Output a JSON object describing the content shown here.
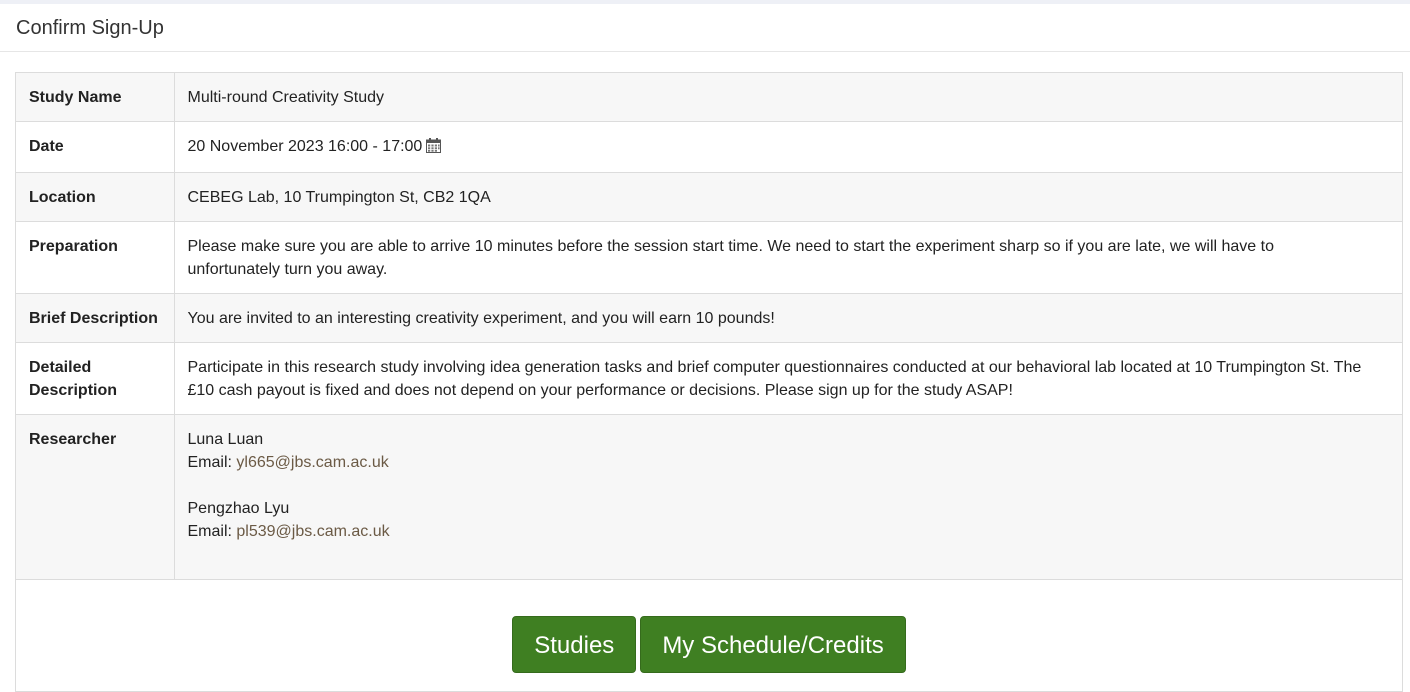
{
  "header": {
    "title": "Confirm Sign-Up"
  },
  "study": {
    "rows": {
      "study_name": {
        "label": "Study Name",
        "value": "Multi-round Creativity Study"
      },
      "date": {
        "label": "Date",
        "value": "20 November 2023 16:00 - 17:00",
        "icon": "calendar-icon"
      },
      "location": {
        "label": "Location",
        "value": "CEBEG Lab, 10 Trumpington St, CB2 1QA"
      },
      "preparation": {
        "label": "Preparation",
        "value": "Please make sure you are able to arrive 10 minutes before the session start time. We need to start the experiment sharp so if you are late, we will have to unfortunately turn you away."
      },
      "brief_description": {
        "label": "Brief Description",
        "value": "You are invited to an interesting creativity experiment, and you will earn 10 pounds!"
      },
      "detailed_description": {
        "label": "Detailed Description",
        "value": "Participate in this research study involving idea generation tasks and brief computer questionnaires conducted at our behavioral lab located at 10 Trumpington St. The £10 cash payout is fixed and does not depend on your performance or decisions. Please sign up for the study ASAP!"
      },
      "researcher": {
        "label": "Researcher",
        "email_prefix": "Email: ",
        "people": [
          {
            "name": "Luna Luan",
            "email": "yl665@jbs.cam.ac.uk"
          },
          {
            "name": "Pengzhao Lyu",
            "email": "pl539@jbs.cam.ac.uk"
          }
        ]
      }
    }
  },
  "buttons": {
    "studies": "Studies",
    "schedule": "My Schedule/Credits"
  },
  "colors": {
    "button_green": "#3f7f22",
    "link_brown": "#6b5a45",
    "row_stripe": "#f7f7f7",
    "border": "#dcdcdc"
  }
}
